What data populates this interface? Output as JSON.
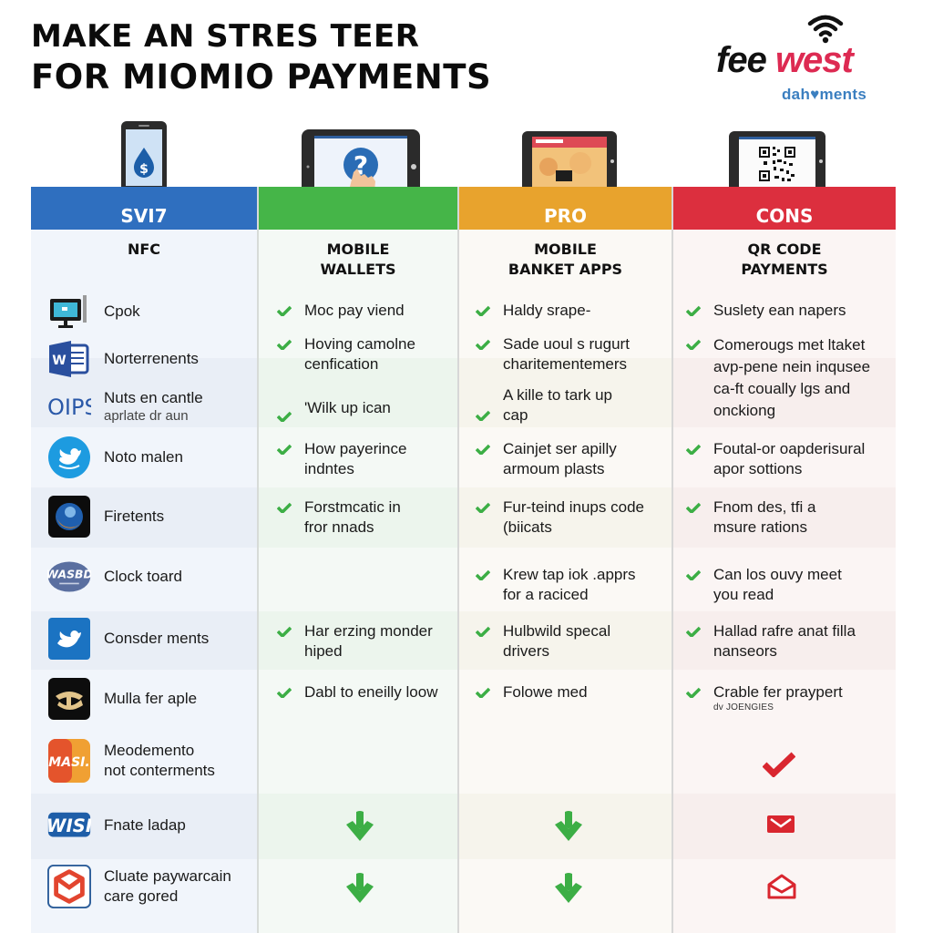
{
  "title": {
    "line1": "MAKE AN STRES TEER",
    "line2": "FOR MIOMIO PAYMENTS"
  },
  "logo": {
    "word1": "fee",
    "word2": "west",
    "subtitle": "dah♥ments",
    "icon": "wifi-icon",
    "colors": {
      "dark": "#111111",
      "accent": "#dd2a52",
      "sub": "#3b7fc0"
    }
  },
  "columns": [
    {
      "band_label": "SVI7",
      "subhead": [
        "NFC"
      ],
      "color": "#2f6fbf",
      "device_icon": "smartphone-dollar-icon"
    },
    {
      "band_label": "",
      "subhead": [
        "MOBILE",
        "WALLETS"
      ],
      "color": "#45b548",
      "device_icon": "tablet-question-touch-icon"
    },
    {
      "band_label": "PRO",
      "subhead": [
        "MOBILE",
        "BANKET APPS"
      ],
      "color": "#e8a32d",
      "device_icon": "laptop-banking-app-icon"
    },
    {
      "band_label": "CONS",
      "subhead": [
        "QR CODE",
        "PAYMENTS"
      ],
      "color": "#dc2f3e",
      "device_icon": "laptop-qr-code-icon"
    }
  ],
  "left_rows": [
    {
      "icon": "desktop-monitor-icon",
      "label": "Cpok",
      "sub": ""
    },
    {
      "icon": "word-document-icon",
      "label": "Norterrenents",
      "sub": ""
    },
    {
      "icon": "oips-logo-icon",
      "label": "Nuts en cantle",
      "sub": "aprlate dr aun"
    },
    {
      "icon": "twitter-bird-round-icon",
      "label": "Noto malen",
      "sub": ""
    },
    {
      "icon": "firefox-browser-icon",
      "label": "Firetents",
      "sub": ""
    },
    {
      "icon": "wasbd-badge-icon",
      "label": "Clock toard",
      "sub": ""
    },
    {
      "icon": "twitter-bird-square-icon",
      "label": "Consder ments",
      "sub": ""
    },
    {
      "icon": "gold-emblem-app-icon",
      "label": "Mulla fer aple",
      "sub": ""
    },
    {
      "icon": "mast-app-icon",
      "label": "Meodemento",
      "sub": "not conterments"
    },
    {
      "icon": "wisi-logo-icon",
      "label": "Fnate ladap",
      "sub": ""
    },
    {
      "icon": "hexagon-mail-icon",
      "label": "Cluate paywarcain",
      "sub": "care gored"
    }
  ],
  "wallet_items": [
    {
      "lines": [
        "Moc pay viend"
      ]
    },
    {
      "lines": [
        "Hoving camolne",
        "cenfication"
      ]
    },
    {
      "lines": [
        "'Wilk up ican"
      ]
    },
    {
      "lines": [
        "How payerince",
        "indntes"
      ]
    },
    {
      "lines": [
        "Forstmcatic in",
        "fror nnads"
      ]
    },
    {
      "lines": [
        "Har erzing monder",
        "hiped"
      ]
    },
    {
      "lines": [
        "Dabl to eneilly loow"
      ]
    }
  ],
  "banking_items": [
    {
      "lines": [
        "Haldy srape-"
      ]
    },
    {
      "lines": [
        "Sade uoul s rugurt",
        "charitementemers"
      ]
    },
    {
      "lines": [
        "A kille to tark up",
        "cap"
      ]
    },
    {
      "lines": [
        "Cainjet ser apilly",
        "armoum plasts"
      ]
    },
    {
      "lines": [
        "Fur-teind inups code",
        "(biicats"
      ]
    },
    {
      "lines": [
        "Krew tap iok .apprs",
        "for a raciced"
      ]
    },
    {
      "lines": [
        "Hulbwild specal",
        "drivers"
      ]
    },
    {
      "lines": [
        "Folowe med"
      ]
    }
  ],
  "qr_items": [
    {
      "lines": [
        "Suslety ean napers"
      ]
    },
    {
      "lines": [
        "Comerougs met ltaket",
        "avp-pene nein inqusee",
        "ca-ft coually lgs and",
        "onckiong"
      ]
    },
    {
      "lines": [
        "Foutal-or oapderisural",
        "apor sottions"
      ]
    },
    {
      "lines": [
        "Fnom des, tfi a",
        "msure rations"
      ]
    },
    {
      "lines": [
        "Can los ouvy meet",
        "you read"
      ]
    },
    {
      "lines": [
        "Hallad rafre anat filla",
        "nanseors"
      ]
    },
    {
      "lines": [
        "Crable fer praypert"
      ],
      "note": "dv JOENGIES"
    }
  ],
  "bottom_icons": {
    "wallets": [
      "download-arrow-icon",
      "download-arrow-icon"
    ],
    "banking": [
      "download-arrow-icon",
      "download-arrow-icon"
    ],
    "qr": [
      "red-checkmark-icon",
      "red-envelope-icon",
      "open-envelope-icon"
    ]
  }
}
